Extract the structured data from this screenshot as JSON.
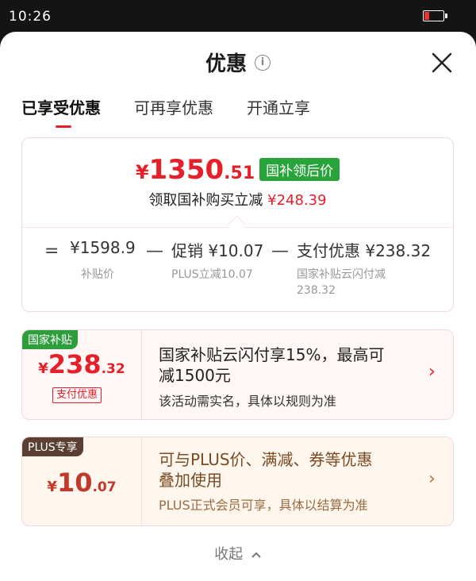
{
  "status": {
    "time": "10:26"
  },
  "header": {
    "title": "优惠",
    "info_icon": "i"
  },
  "tabs": [
    {
      "label": "已享受优惠"
    },
    {
      "label": "可再享优惠"
    },
    {
      "label": "开通立享"
    }
  ],
  "summary": {
    "currency": "¥",
    "final_int": "1350",
    "final_dec": ".51",
    "badge": "国补领后价",
    "subsidy_text": "领取国补购买立减",
    "subsidy_amount": "¥248.39",
    "equation": {
      "eq": "=",
      "base_value": "¥1598.9",
      "base_caption": "补贴价",
      "minus1": "—",
      "promo_value": "促销 ¥10.07",
      "promo_caption": "PLUS立减10.07",
      "minus2": "—",
      "pay_value": "支付优惠 ¥238.32",
      "pay_caption_1": "国家补贴云闪付减",
      "pay_caption_2": "238.32"
    }
  },
  "offer_subsidy": {
    "tag": "国家补贴",
    "currency": "¥",
    "amount_int": "238",
    "amount_dec": ".32",
    "pill": "支付优惠",
    "title_1": "国家补贴云闪付享15%，最高可",
    "title_2": "减1500元",
    "note": "该活动需实名，具体以规则为准",
    "chevron": "›"
  },
  "offer_plus": {
    "tag": "PLUS专享",
    "currency": "¥",
    "amount_int": "10",
    "amount_dec": ".07",
    "title_1": "可与PLUS价、满减、券等优惠",
    "title_2": "叠加使用",
    "note": "PLUS正式会员可享，具体以结算为准",
    "chevron": "›"
  },
  "footer": {
    "collapse": "收起"
  },
  "colors": {
    "accent": "#e5202a",
    "badge_green": "#29a33b",
    "plus_brown": "#5a3f32"
  }
}
